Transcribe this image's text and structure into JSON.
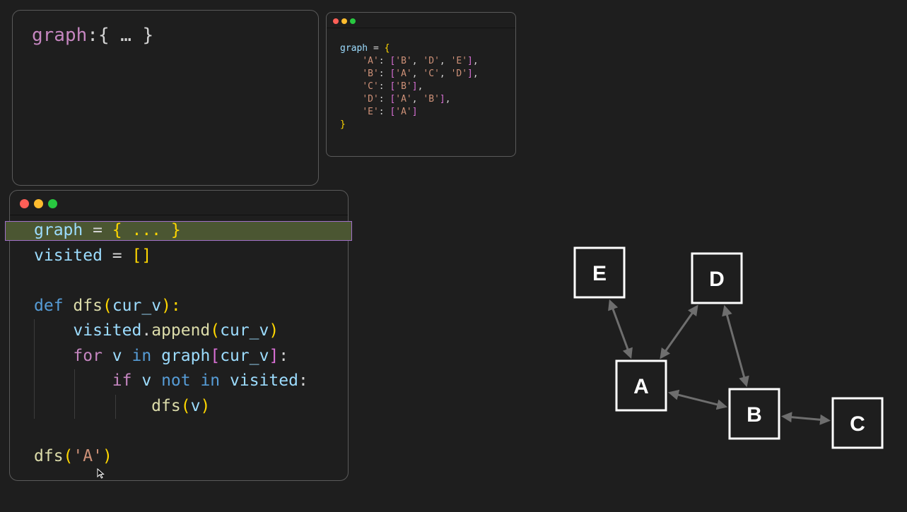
{
  "variables_panel": {
    "name": "graph",
    "separator": ":",
    "value": "{ … }"
  },
  "graph_window": {
    "lines": [
      [
        [
          "k-var",
          "graph"
        ],
        [
          "k-plain",
          " = "
        ],
        [
          "k-brace",
          "{"
        ]
      ],
      [
        [
          "k-plain",
          "    "
        ],
        [
          "k-str",
          "'A'"
        ],
        [
          "k-plain",
          ": "
        ],
        [
          "k-bracket",
          "["
        ],
        [
          "k-str",
          "'B'"
        ],
        [
          "k-plain",
          ", "
        ],
        [
          "k-str",
          "'D'"
        ],
        [
          "k-plain",
          ", "
        ],
        [
          "k-str",
          "'E'"
        ],
        [
          "k-bracket",
          "]"
        ],
        [
          "k-plain",
          ","
        ]
      ],
      [
        [
          "k-plain",
          "    "
        ],
        [
          "k-str",
          "'B'"
        ],
        [
          "k-plain",
          ": "
        ],
        [
          "k-bracket",
          "["
        ],
        [
          "k-str",
          "'A'"
        ],
        [
          "k-plain",
          ", "
        ],
        [
          "k-str",
          "'C'"
        ],
        [
          "k-plain",
          ", "
        ],
        [
          "k-str",
          "'D'"
        ],
        [
          "k-bracket",
          "]"
        ],
        [
          "k-plain",
          ","
        ]
      ],
      [
        [
          "k-plain",
          "    "
        ],
        [
          "k-str",
          "'C'"
        ],
        [
          "k-plain",
          ": "
        ],
        [
          "k-bracket",
          "["
        ],
        [
          "k-str",
          "'B'"
        ],
        [
          "k-bracket",
          "]"
        ],
        [
          "k-plain",
          ","
        ]
      ],
      [
        [
          "k-plain",
          "    "
        ],
        [
          "k-str",
          "'D'"
        ],
        [
          "k-plain",
          ": "
        ],
        [
          "k-bracket",
          "["
        ],
        [
          "k-str",
          "'A'"
        ],
        [
          "k-plain",
          ", "
        ],
        [
          "k-str",
          "'B'"
        ],
        [
          "k-bracket",
          "]"
        ],
        [
          "k-plain",
          ","
        ]
      ],
      [
        [
          "k-plain",
          "    "
        ],
        [
          "k-str",
          "'E'"
        ],
        [
          "k-plain",
          ": "
        ],
        [
          "k-bracket",
          "["
        ],
        [
          "k-str",
          "'A'"
        ],
        [
          "k-bracket",
          "]"
        ]
      ],
      [
        [
          "k-brace",
          "}"
        ]
      ]
    ]
  },
  "main_editor": {
    "highlighted_line": 0,
    "lines": [
      [
        [
          "k-var",
          "graph"
        ],
        [
          "k-plain",
          " = "
        ],
        [
          "k-brace",
          "{ ... }"
        ]
      ],
      [
        [
          "k-var",
          "visited"
        ],
        [
          "k-plain",
          " = "
        ],
        [
          "k-brace",
          "[]"
        ]
      ],
      [],
      [
        [
          "k-kw",
          "def"
        ],
        [
          "k-plain",
          " "
        ],
        [
          "k-fn",
          "dfs"
        ],
        [
          "k-paren",
          "("
        ],
        [
          "k-var",
          "cur_v"
        ],
        [
          "k-paren",
          "):"
        ]
      ],
      [
        [
          "k-plain",
          "    "
        ],
        [
          "k-var",
          "visited"
        ],
        [
          "k-plain",
          "."
        ],
        [
          "k-fn",
          "append"
        ],
        [
          "k-paren",
          "("
        ],
        [
          "k-var",
          "cur_v"
        ],
        [
          "k-paren",
          ")"
        ]
      ],
      [
        [
          "k-plain",
          "    "
        ],
        [
          "k-ctrl",
          "for"
        ],
        [
          "k-plain",
          " "
        ],
        [
          "k-var",
          "v"
        ],
        [
          "k-plain",
          " "
        ],
        [
          "k-kw",
          "in"
        ],
        [
          "k-plain",
          " "
        ],
        [
          "k-var",
          "graph"
        ],
        [
          "k-bracket",
          "["
        ],
        [
          "k-var",
          "cur_v"
        ],
        [
          "k-bracket",
          "]"
        ],
        [
          "k-plain",
          ":"
        ]
      ],
      [
        [
          "k-plain",
          "        "
        ],
        [
          "k-ctrl",
          "if"
        ],
        [
          "k-plain",
          " "
        ],
        [
          "k-var",
          "v"
        ],
        [
          "k-plain",
          " "
        ],
        [
          "k-kw",
          "not in"
        ],
        [
          "k-plain",
          " "
        ],
        [
          "k-var",
          "visited"
        ],
        [
          "k-plain",
          ":"
        ]
      ],
      [
        [
          "k-plain",
          "            "
        ],
        [
          "k-fn",
          "dfs"
        ],
        [
          "k-paren",
          "("
        ],
        [
          "k-var",
          "v"
        ],
        [
          "k-paren",
          ")"
        ]
      ],
      [],
      [
        [
          "k-fn",
          "dfs"
        ],
        [
          "k-paren",
          "("
        ],
        [
          "k-str",
          "'A'"
        ],
        [
          "k-paren",
          ")"
        ]
      ]
    ]
  },
  "graph_diagram": {
    "nodes": [
      "E",
      "D",
      "A",
      "B",
      "C"
    ],
    "edges": [
      [
        "A",
        "E"
      ],
      [
        "A",
        "D"
      ],
      [
        "B",
        "D"
      ],
      [
        "A",
        "B"
      ],
      [
        "B",
        "C"
      ]
    ],
    "edge_color": "#6e6e6e",
    "node_border_color": "#ffffff"
  }
}
